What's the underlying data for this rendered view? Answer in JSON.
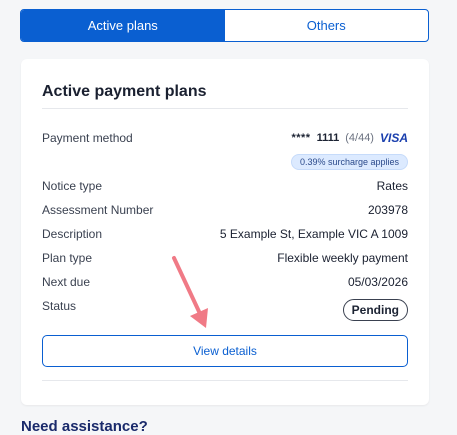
{
  "tabs": [
    {
      "label": "Active plans",
      "active": true
    },
    {
      "label": "Others",
      "active": false
    }
  ],
  "card": {
    "title": "Active payment plans",
    "payment_method": {
      "label": "Payment method",
      "masked": "****",
      "last4": "1111",
      "expiry": "(4/44)",
      "brand": "VISA",
      "surcharge": "0.39% surcharge applies"
    },
    "rows": [
      {
        "label": "Notice type",
        "value": "Rates"
      },
      {
        "label": "Assessment Number",
        "value": "203978"
      },
      {
        "label": "Description",
        "value": "5 Example St, Example VIC A 1009"
      },
      {
        "label": "Plan type",
        "value": "Flexible weekly payment"
      },
      {
        "label": "Next due",
        "value": "05/03/2026"
      }
    ],
    "status": {
      "label": "Status",
      "value": "Pending"
    },
    "button": "View details"
  },
  "footer_peek": "Need assistance?",
  "colors": {
    "primary": "#0a5fd1",
    "arrow": "#f07a86"
  }
}
